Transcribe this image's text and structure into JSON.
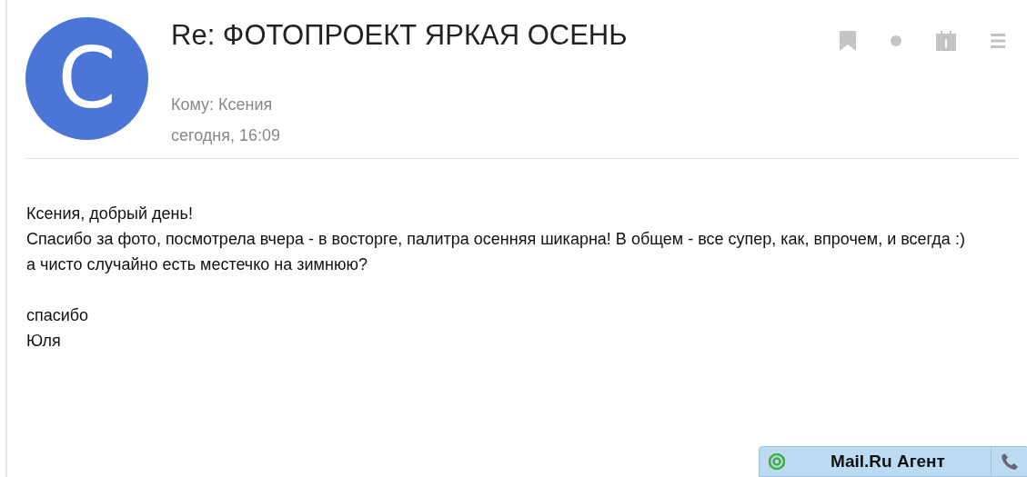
{
  "avatar": {
    "letter": "C"
  },
  "subject": "Re: ФОТОПРОЕКТ ЯРКАЯ ОСЕНЬ",
  "to": "Кому: Ксения",
  "date": "сегодня, 16:09",
  "body": [
    [
      "Ксения, добрый день!",
      "Спасибо за фото, посмотрела вчера - в восторге, палитра осенняя шикарна! В общем - все супер, как, впрочем, и всегда :)",
      "а чисто случайно есть местечко на зимнюю?"
    ],
    [
      "спасибо",
      "Юля"
    ]
  ],
  "agent": {
    "title": "Mail.Ru Агент"
  }
}
